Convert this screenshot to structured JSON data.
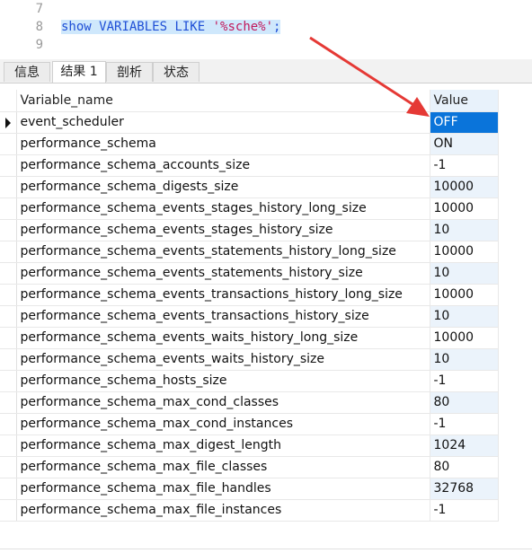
{
  "editor": {
    "line_numbers": [
      "7",
      "8",
      "9"
    ],
    "query": {
      "keyword_show": "show",
      "keyword_variables": "VARIABLES",
      "keyword_like": "LIKE",
      "pattern": "'%sche%'",
      "terminator": ";"
    }
  },
  "tabs": [
    {
      "label": "信息",
      "active": false
    },
    {
      "label": "结果 1",
      "active": true
    },
    {
      "label": "剖析",
      "active": false
    },
    {
      "label": "状态",
      "active": false
    }
  ],
  "grid": {
    "headers": {
      "name": "Variable_name",
      "value": "Value"
    },
    "rows": [
      {
        "name": "event_scheduler",
        "value": "OFF"
      },
      {
        "name": "performance_schema",
        "value": "ON"
      },
      {
        "name": "performance_schema_accounts_size",
        "value": "-1"
      },
      {
        "name": "performance_schema_digests_size",
        "value": "10000"
      },
      {
        "name": "performance_schema_events_stages_history_long_size",
        "value": "10000"
      },
      {
        "name": "performance_schema_events_stages_history_size",
        "value": "10"
      },
      {
        "name": "performance_schema_events_statements_history_long_size",
        "value": "10000"
      },
      {
        "name": "performance_schema_events_statements_history_size",
        "value": "10"
      },
      {
        "name": "performance_schema_events_transactions_history_long_size",
        "value": "10000"
      },
      {
        "name": "performance_schema_events_transactions_history_size",
        "value": "10"
      },
      {
        "name": "performance_schema_events_waits_history_long_size",
        "value": "10000"
      },
      {
        "name": "performance_schema_events_waits_history_size",
        "value": "10"
      },
      {
        "name": "performance_schema_hosts_size",
        "value": "-1"
      },
      {
        "name": "performance_schema_max_cond_classes",
        "value": "80"
      },
      {
        "name": "performance_schema_max_cond_instances",
        "value": "-1"
      },
      {
        "name": "performance_schema_max_digest_length",
        "value": "1024"
      },
      {
        "name": "performance_schema_max_file_classes",
        "value": "80"
      },
      {
        "name": "performance_schema_max_file_handles",
        "value": "32768"
      },
      {
        "name": "performance_schema_max_file_instances",
        "value": "-1"
      }
    ],
    "selected_row": 0
  },
  "colors": {
    "selection": "#0a74da",
    "alt_row": "#ebf3fb",
    "annotation_arrow": "#e53935",
    "sql_keyword": "#1f4fd6",
    "sql_string": "#c2185b"
  }
}
